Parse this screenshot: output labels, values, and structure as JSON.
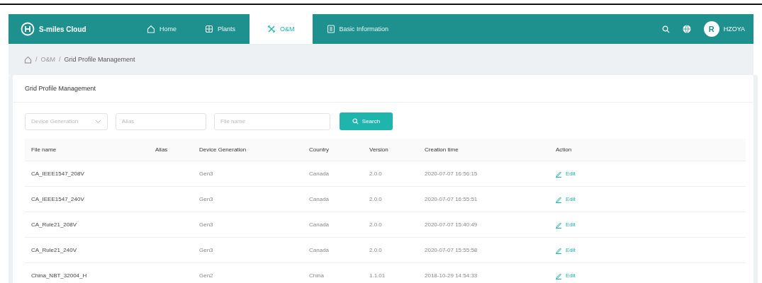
{
  "app": {
    "brand": "S-miles Cloud"
  },
  "nav": [
    {
      "label": "Home",
      "selected": false
    },
    {
      "label": "Plants",
      "selected": false
    },
    {
      "label": "O&M",
      "selected": true
    },
    {
      "label": "Basic Information",
      "selected": false
    }
  ],
  "user": {
    "avatar": "R",
    "name": "HZOYA"
  },
  "breadcrumb": [
    {
      "separator": "/",
      "label": "O&M"
    },
    {
      "separator": "/",
      "label": "Grid Profile Management"
    }
  ],
  "card": {
    "title": "Grid Profile Management"
  },
  "filters": {
    "generation": {
      "placeholder": "Device Generation"
    },
    "alias": {
      "placeholder": "Alias"
    },
    "file": {
      "placeholder": "File name"
    },
    "search_button": "Search"
  },
  "table": {
    "columns": [
      "File name",
      "Alias",
      "Device Generation",
      "Country",
      "Version",
      "Creation time",
      "Action"
    ],
    "rows": [
      {
        "file": "CA_IEEE1547_208V",
        "generation": "Gen3",
        "country": "Canada",
        "version": "2.0.0",
        "time": "2020-07-07 16:56:15",
        "action": "Edit"
      },
      {
        "file": "CA_IEEE1547_240V",
        "generation": "Gen3",
        "country": "Canada",
        "version": "2.0.0",
        "time": "2020-07-07 16:55:51",
        "action": "Edit"
      },
      {
        "file": "CA_Rule21_208V",
        "generation": "Gen3",
        "country": "Canada",
        "version": "2.0.0",
        "time": "2020-07-07 15:40:49",
        "action": "Edit"
      },
      {
        "file": "CA_Rule21_240V",
        "generation": "Gen3",
        "country": "Canada",
        "version": "2.0.0",
        "time": "2020-07-07 15:55:58",
        "action": "Edit"
      },
      {
        "file": "China_NBT_32004_H",
        "generation": "Gen2",
        "country": "China",
        "version": "1.1.01",
        "time": "2018-10-29 14:54:33",
        "action": "Edit"
      }
    ]
  }
}
